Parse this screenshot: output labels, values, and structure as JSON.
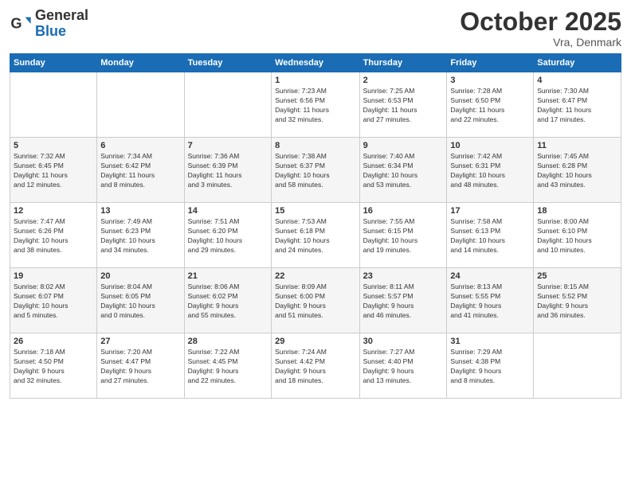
{
  "header": {
    "logo": {
      "general": "General",
      "blue": "Blue"
    },
    "title": "October 2025",
    "location": "Vra, Denmark"
  },
  "calendar": {
    "headers": [
      "Sunday",
      "Monday",
      "Tuesday",
      "Wednesday",
      "Thursday",
      "Friday",
      "Saturday"
    ],
    "weeks": [
      [
        {
          "day": "",
          "info": ""
        },
        {
          "day": "",
          "info": ""
        },
        {
          "day": "",
          "info": ""
        },
        {
          "day": "1",
          "info": "Sunrise: 7:23 AM\nSunset: 6:56 PM\nDaylight: 11 hours\nand 32 minutes."
        },
        {
          "day": "2",
          "info": "Sunrise: 7:25 AM\nSunset: 6:53 PM\nDaylight: 11 hours\nand 27 minutes."
        },
        {
          "day": "3",
          "info": "Sunrise: 7:28 AM\nSunset: 6:50 PM\nDaylight: 11 hours\nand 22 minutes."
        },
        {
          "day": "4",
          "info": "Sunrise: 7:30 AM\nSunset: 6:47 PM\nDaylight: 11 hours\nand 17 minutes."
        }
      ],
      [
        {
          "day": "5",
          "info": "Sunrise: 7:32 AM\nSunset: 6:45 PM\nDaylight: 11 hours\nand 12 minutes."
        },
        {
          "day": "6",
          "info": "Sunrise: 7:34 AM\nSunset: 6:42 PM\nDaylight: 11 hours\nand 8 minutes."
        },
        {
          "day": "7",
          "info": "Sunrise: 7:36 AM\nSunset: 6:39 PM\nDaylight: 11 hours\nand 3 minutes."
        },
        {
          "day": "8",
          "info": "Sunrise: 7:38 AM\nSunset: 6:37 PM\nDaylight: 10 hours\nand 58 minutes."
        },
        {
          "day": "9",
          "info": "Sunrise: 7:40 AM\nSunset: 6:34 PM\nDaylight: 10 hours\nand 53 minutes."
        },
        {
          "day": "10",
          "info": "Sunrise: 7:42 AM\nSunset: 6:31 PM\nDaylight: 10 hours\nand 48 minutes."
        },
        {
          "day": "11",
          "info": "Sunrise: 7:45 AM\nSunset: 6:28 PM\nDaylight: 10 hours\nand 43 minutes."
        }
      ],
      [
        {
          "day": "12",
          "info": "Sunrise: 7:47 AM\nSunset: 6:26 PM\nDaylight: 10 hours\nand 38 minutes."
        },
        {
          "day": "13",
          "info": "Sunrise: 7:49 AM\nSunset: 6:23 PM\nDaylight: 10 hours\nand 34 minutes."
        },
        {
          "day": "14",
          "info": "Sunrise: 7:51 AM\nSunset: 6:20 PM\nDaylight: 10 hours\nand 29 minutes."
        },
        {
          "day": "15",
          "info": "Sunrise: 7:53 AM\nSunset: 6:18 PM\nDaylight: 10 hours\nand 24 minutes."
        },
        {
          "day": "16",
          "info": "Sunrise: 7:55 AM\nSunset: 6:15 PM\nDaylight: 10 hours\nand 19 minutes."
        },
        {
          "day": "17",
          "info": "Sunrise: 7:58 AM\nSunset: 6:13 PM\nDaylight: 10 hours\nand 14 minutes."
        },
        {
          "day": "18",
          "info": "Sunrise: 8:00 AM\nSunset: 6:10 PM\nDaylight: 10 hours\nand 10 minutes."
        }
      ],
      [
        {
          "day": "19",
          "info": "Sunrise: 8:02 AM\nSunset: 6:07 PM\nDaylight: 10 hours\nand 5 minutes."
        },
        {
          "day": "20",
          "info": "Sunrise: 8:04 AM\nSunset: 6:05 PM\nDaylight: 10 hours\nand 0 minutes."
        },
        {
          "day": "21",
          "info": "Sunrise: 8:06 AM\nSunset: 6:02 PM\nDaylight: 9 hours\nand 55 minutes."
        },
        {
          "day": "22",
          "info": "Sunrise: 8:09 AM\nSunset: 6:00 PM\nDaylight: 9 hours\nand 51 minutes."
        },
        {
          "day": "23",
          "info": "Sunrise: 8:11 AM\nSunset: 5:57 PM\nDaylight: 9 hours\nand 46 minutes."
        },
        {
          "day": "24",
          "info": "Sunrise: 8:13 AM\nSunset: 5:55 PM\nDaylight: 9 hours\nand 41 minutes."
        },
        {
          "day": "25",
          "info": "Sunrise: 8:15 AM\nSunset: 5:52 PM\nDaylight: 9 hours\nand 36 minutes."
        }
      ],
      [
        {
          "day": "26",
          "info": "Sunrise: 7:18 AM\nSunset: 4:50 PM\nDaylight: 9 hours\nand 32 minutes."
        },
        {
          "day": "27",
          "info": "Sunrise: 7:20 AM\nSunset: 4:47 PM\nDaylight: 9 hours\nand 27 minutes."
        },
        {
          "day": "28",
          "info": "Sunrise: 7:22 AM\nSunset: 4:45 PM\nDaylight: 9 hours\nand 22 minutes."
        },
        {
          "day": "29",
          "info": "Sunrise: 7:24 AM\nSunset: 4:42 PM\nDaylight: 9 hours\nand 18 minutes."
        },
        {
          "day": "30",
          "info": "Sunrise: 7:27 AM\nSunset: 4:40 PM\nDaylight: 9 hours\nand 13 minutes."
        },
        {
          "day": "31",
          "info": "Sunrise: 7:29 AM\nSunset: 4:38 PM\nDaylight: 9 hours\nand 8 minutes."
        },
        {
          "day": "",
          "info": ""
        }
      ]
    ]
  }
}
